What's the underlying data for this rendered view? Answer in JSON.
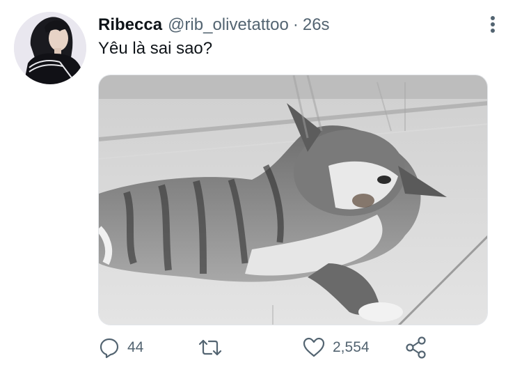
{
  "tweet": {
    "author": {
      "display_name": "Ribecca",
      "handle": "@rib_olivetattoo"
    },
    "separator": "·",
    "time": "26s",
    "text": "Yêu là sai sao?",
    "media": {
      "alt": "cat lying on the floor"
    },
    "actions": {
      "reply_count": "44",
      "retweet_count": "",
      "like_count": "2,554"
    }
  },
  "icons": {
    "more": "more-vertical-icon",
    "reply": "reply-icon",
    "retweet": "retweet-icon",
    "like": "heart-icon",
    "share": "share-icon"
  },
  "colors": {
    "text_primary": "#0f1419",
    "text_secondary": "#536471"
  }
}
